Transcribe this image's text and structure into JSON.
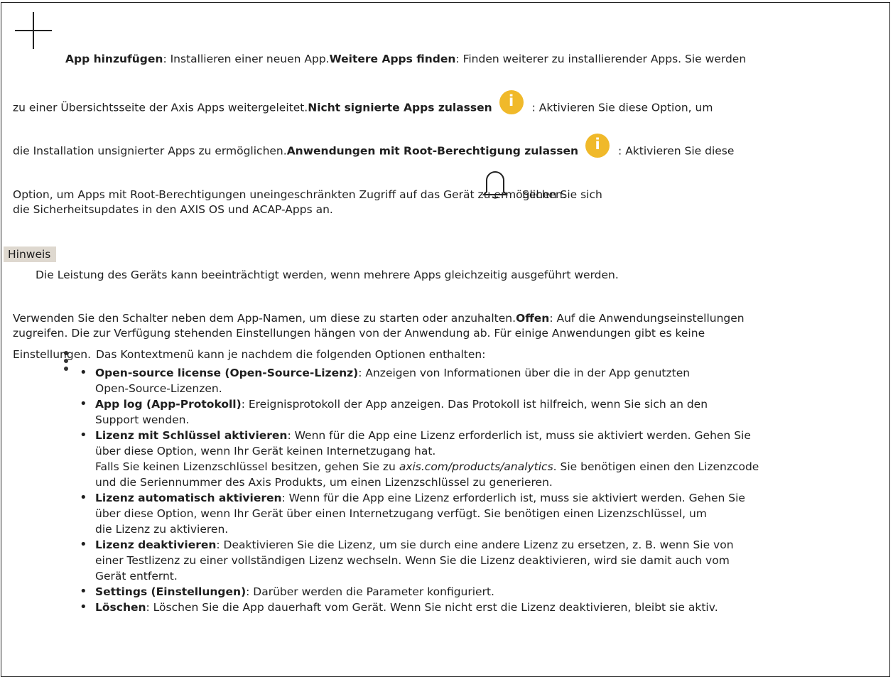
{
  "para1": {
    "add_app_label": "App hinzufügen",
    "add_app_desc": ": Installieren einer neuen App.",
    "more_apps_label": "Weitere Apps finden",
    "more_apps_desc_a": ": Finden weiterer zu installierender Apps. Sie werden",
    "more_apps_desc_b": "zu einer Übersichtsseite der Axis Apps weitergeleitet.",
    "unsigned_label": "Nicht signierte Apps zulassen",
    "unsigned_desc_a": ": Aktivieren Sie diese Option, um",
    "unsigned_desc_b": "die Installation unsignierter Apps zu ermöglichen.",
    "root_label": "Anwendungen mit Root-Berechtigung zulassen",
    "root_desc_a": ": Aktivieren Sie diese",
    "root_desc_b": "Option, um Apps mit Root-Berechtigungen uneingeschränkten Zugriff auf das Gerät zu ermöglichen.",
    "security_a": "Sehen Sie sich",
    "security_b": "die Sicherheitsupdates in den AXIS OS und ACAP-Apps an."
  },
  "note": {
    "label": "Hinweis",
    "text": "Die Leistung des Geräts kann beeinträchtigt werden, wenn mehrere Apps gleichzeitig ausgeführt werden."
  },
  "para2": {
    "line1_a": "Verwenden Sie den Schalter neben dem App-Namen, um diese zu starten oder anzuhalten.",
    "open_label": "Offen",
    "line1_b": ": Auf die Anwendungseinstellungen",
    "line2": "zugreifen. Die zur Verfügung stehenden Einstellungen hängen von der Anwendung ab. Für einige Anwendungen gibt es keine",
    "line3_a": "Einstellungen.",
    "line3_b": "Das Kontextmenü kann je nachdem die folgenden Optionen enthalten:"
  },
  "options": [
    {
      "label": "Open-source license (Open-Source-Lizenz)",
      "text": ": Anzeigen von Informationen über die in der App genutzten",
      "text2": "Open-Source-Lizenzen."
    },
    {
      "label": "App log (App-Protokoll)",
      "text": ": Ereignisprotokoll der App anzeigen. Das Protokoll ist hilfreich, wenn Sie sich an den",
      "text2": "Support wenden."
    },
    {
      "label": "Lizenz mit Schlüssel aktivieren",
      "text": ": Wenn für die App eine Lizenz erforderlich ist, muss sie aktiviert werden. Gehen Sie",
      "text2": "über diese Option, wenn Ihr Gerät keinen Internetzugang hat.",
      "extra_a": "Falls Sie keinen Lizenzschlüssel besitzen, gehen Sie zu ",
      "extra_link": "axis.com/products/analytics",
      "extra_b": ". Sie benötigen einen den Lizenzcode",
      "extra_c": "und die Seriennummer des Axis Produkts, um einen Lizenzschlüssel zu generieren."
    },
    {
      "label": "Lizenz automatisch aktivieren",
      "text": ": Wenn für die App eine Lizenz erforderlich ist, muss sie aktiviert werden. Gehen Sie",
      "text2": "über diese Option, wenn Ihr Gerät über einen Internetzugang verfügt. Sie benötigen einen Lizenzschlüssel, um",
      "text3": "die Lizenz zu aktivieren."
    },
    {
      "label": "Lizenz deaktivieren",
      "text": ": Deaktivieren Sie die Lizenz, um sie durch eine andere Lizenz zu ersetzen, z. B. wenn Sie von",
      "text2": "einer Testlizenz zu einer vollständigen Lizenz wechseln. Wenn Sie die Lizenz deaktivieren, wird sie damit auch vom",
      "text3": "Gerät entfernt."
    },
    {
      "label": "Settings (Einstellungen)",
      "text": ": Darüber werden die Parameter konfiguriert."
    },
    {
      "label": "Löschen",
      "text": ": Löschen Sie die App dauerhaft vom Gerät. Wenn Sie nicht erst die Lizenz deaktivieren, bleibt sie aktiv."
    }
  ],
  "icons": {
    "plus": "plus-icon",
    "info": "info-icon",
    "bell": "bell-icon",
    "menu": "more-vertical-icon"
  },
  "colors": {
    "info": "#f0b92a",
    "note_bg": "#ded8cf"
  }
}
